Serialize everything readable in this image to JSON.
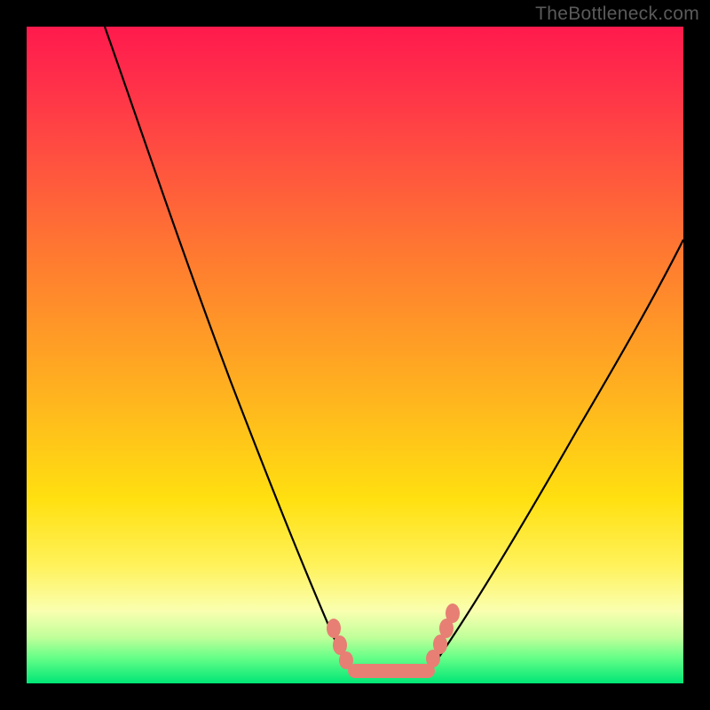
{
  "watermark": "TheBottleneck.com",
  "colors": {
    "frame": "#000000",
    "curve": "#000000",
    "marker": "#e77f74",
    "gradient_top": "#ff1a4d",
    "gradient_bottom": "#00e676"
  },
  "chart_data": {
    "type": "line",
    "title": "",
    "xlabel": "",
    "ylabel": "",
    "xlim": [
      0,
      100
    ],
    "ylim": [
      0,
      100
    ],
    "series": [
      {
        "name": "left-curve",
        "x": [
          12,
          15,
          18,
          22,
          26,
          30,
          34,
          38,
          42,
          46,
          49
        ],
        "y": [
          100,
          92,
          83,
          72,
          61,
          50,
          39,
          28,
          18,
          8,
          2
        ]
      },
      {
        "name": "valley-floor",
        "x": [
          49,
          62
        ],
        "y": [
          2,
          2
        ]
      },
      {
        "name": "right-curve",
        "x": [
          62,
          66,
          70,
          75,
          80,
          86,
          92,
          100
        ],
        "y": [
          2,
          7,
          13,
          21,
          30,
          41,
          53,
          68
        ]
      }
    ],
    "annotations": {
      "flat_band": {
        "x_start": 49,
        "x_end": 62,
        "y": 2
      },
      "markers_left": [
        {
          "x": 46.5,
          "y": 7
        },
        {
          "x": 47.5,
          "y": 4.5
        },
        {
          "x": 48.5,
          "y": 2.5
        }
      ],
      "markers_right": [
        {
          "x": 61.5,
          "y": 3
        },
        {
          "x": 62.5,
          "y": 5
        },
        {
          "x": 63.3,
          "y": 7.5
        },
        {
          "x": 64.0,
          "y": 9.5
        }
      ]
    },
    "grid": false,
    "legend": false
  }
}
